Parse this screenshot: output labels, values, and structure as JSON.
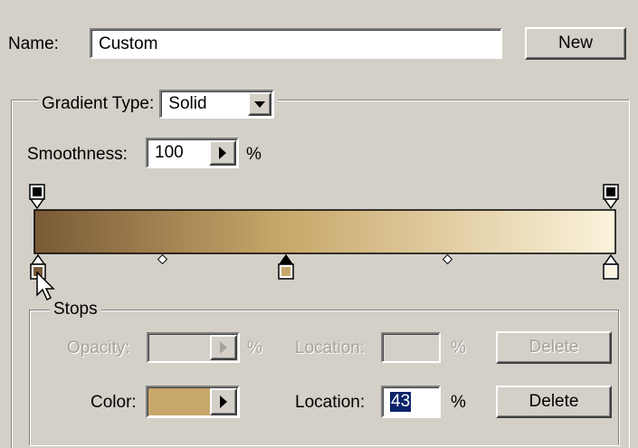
{
  "name_row": {
    "label": "Name:",
    "value": "Custom",
    "new_button": "New"
  },
  "gradient_type": {
    "label": "Gradient Type:",
    "selected": "Solid"
  },
  "smoothness": {
    "label": "Smoothness:",
    "value": "100",
    "unit": "%"
  },
  "gradient": {
    "start_color": "#7a5a36",
    "mid_color": "#c8a86a",
    "end_color": "#fbf3dc",
    "opacity_stops": [
      {
        "location_percent": 0,
        "color": "#000000"
      },
      {
        "location_percent": 100,
        "color": "#000000"
      }
    ],
    "color_stops": [
      {
        "location_percent": 0,
        "color": "#7a5a36",
        "selected": false
      },
      {
        "location_percent": 43,
        "color": "#c8a86a",
        "selected": true
      },
      {
        "location_percent": 100,
        "color": "#fbf3dc",
        "selected": false
      }
    ],
    "midpoints_percent": [
      21,
      71
    ]
  },
  "stops": {
    "legend": "Stops",
    "opacity_label": "Opacity:",
    "opacity_unit": "%",
    "opacity_location_label": "Location:",
    "opacity_location_unit": "%",
    "opacity_delete": "Delete",
    "color_label": "Color:",
    "color_swatch": "#c8a86a",
    "color_location_label": "Location:",
    "color_location_value": "43",
    "color_location_unit": "%",
    "color_delete": "Delete"
  }
}
